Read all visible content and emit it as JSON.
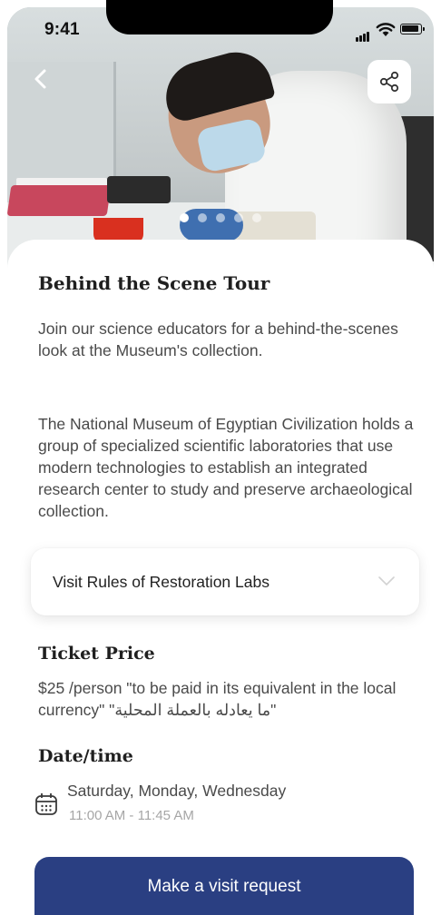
{
  "status_bar": {
    "time": "9:41"
  },
  "hero": {
    "slide_count": 5,
    "active_slide": 1
  },
  "event": {
    "title": "Behind the Scene Tour",
    "intro": "Join our science educators for a behind-the-scenes look at the Museum's collection.",
    "description": "The National Museum of Egyptian Civilization holds a group of specialized scientific laboratories that use modern technologies to establish an integrated research center to study and preserve archaeological collection."
  },
  "rules_accordion": {
    "label": "Visit Rules of Restoration Labs"
  },
  "ticket": {
    "heading": "Ticket Price",
    "text": "$25 /person \"to be paid in its equivalent in the local currency\" \"ما يعادله بالعملة المحلية\""
  },
  "schedule": {
    "heading": "Date/time",
    "days": "Saturday, Monday, Wednesday",
    "hours": "11:00 AM - 11:45 AM"
  },
  "cta": {
    "label": "Make a visit request"
  },
  "colors": {
    "primary": "#2a3f82",
    "muted_text": "#a6a6a6",
    "body_text": "#4a4a4a"
  },
  "icons": [
    "back-arrow-icon",
    "share-icon",
    "calendar-icon",
    "chevron-down-icon"
  ]
}
